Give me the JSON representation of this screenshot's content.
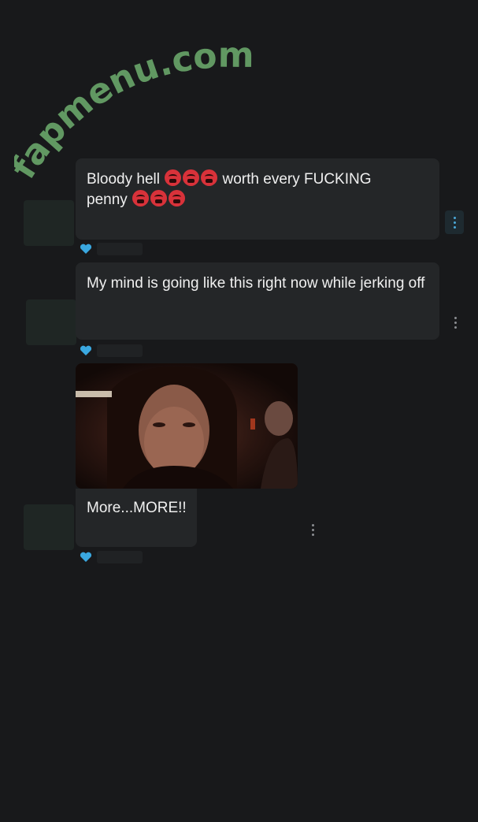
{
  "watermark": {
    "text": "fapmenu.com"
  },
  "messages": [
    {
      "text_a": "Bloody hell",
      "text_b": "worth every FUCKING",
      "text_c": "penny",
      "emoji_name": "angry-face-emoji"
    },
    {
      "text": "My mind is going like this right now while jerking off"
    },
    {
      "media_icon": "gif-image",
      "caption": "More...MORE!!"
    }
  ],
  "colors": {
    "background": "#18191b",
    "bubble": "#242628",
    "heart": "#3aa8e0",
    "watermark": "#6aa66a"
  }
}
